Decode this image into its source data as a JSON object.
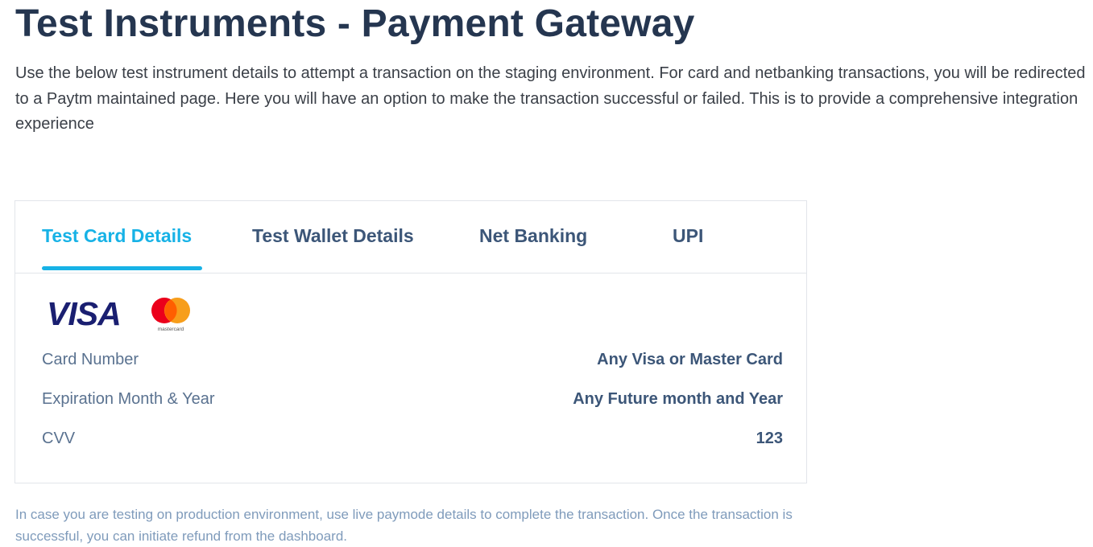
{
  "header": {
    "title": "Test Instruments - Payment Gateway",
    "intro": "Use the below test instrument details to attempt a transaction on the staging environment. For card and netbanking transactions, you will be redirected to a Paytm maintained page. Here you will have an option to make the transaction successful or failed. This is to provide a comprehensive integration experience"
  },
  "tabs": [
    {
      "label": "Test Card Details",
      "active": true
    },
    {
      "label": "Test Wallet Details",
      "active": false
    },
    {
      "label": "Net Banking",
      "active": false
    },
    {
      "label": "UPI",
      "active": false
    }
  ],
  "card_logos": {
    "visa": "VISA",
    "mastercard": "mastercard"
  },
  "details": [
    {
      "label": "Card Number",
      "value": "Any Visa or Master Card"
    },
    {
      "label": "Expiration Month & Year",
      "value": "Any Future month and Year"
    },
    {
      "label": "CVV",
      "value": "123"
    }
  ],
  "footer": {
    "note": "In case you are testing on production environment, use live paymode details to complete the transaction. Once the transaction is successful, you can initiate refund from the dashboard."
  },
  "colors": {
    "title": "#253650",
    "accent": "#17b2e6",
    "tab_text": "#3c5678",
    "label": "#5a7290",
    "note": "#7f9bbb",
    "visa_blue": "#1a1f71",
    "mc_red": "#eb001b",
    "mc_orange": "#f79e1b"
  }
}
